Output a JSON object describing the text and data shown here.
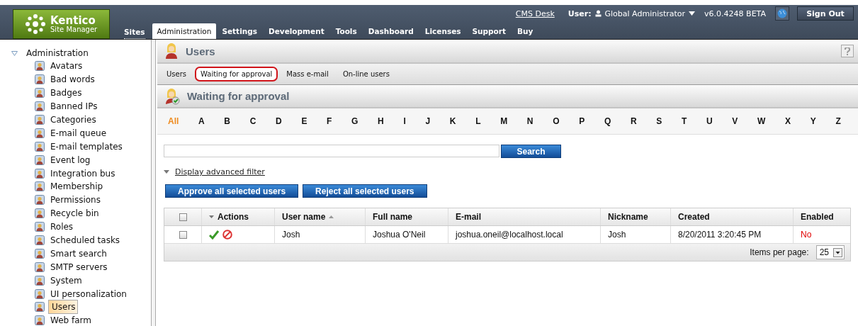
{
  "header": {
    "logo_title": "Kentico",
    "logo_subtitle": "Site Manager",
    "cms_desk_link": "CMS Desk",
    "user_label": "User:",
    "user_name": "Global Administrator",
    "version": "v6.0.4248 BETA",
    "sign_out": "Sign Out"
  },
  "sites_link": "Sites",
  "main_tabs": [
    {
      "label": "Administration",
      "selected": true
    },
    {
      "label": "Settings",
      "selected": false
    },
    {
      "label": "Development",
      "selected": false
    },
    {
      "label": "Tools",
      "selected": false
    },
    {
      "label": "Dashboard",
      "selected": false
    },
    {
      "label": "Licenses",
      "selected": false
    },
    {
      "label": "Support",
      "selected": false
    },
    {
      "label": "Buy",
      "selected": false
    }
  ],
  "sidebar": {
    "label": "Administration",
    "expanded": true,
    "children": [
      {
        "label": "Avatars",
        "selected": false
      },
      {
        "label": "Bad words",
        "selected": false
      },
      {
        "label": "Badges",
        "selected": false
      },
      {
        "label": "Banned IPs",
        "selected": false
      },
      {
        "label": "Categories",
        "selected": false
      },
      {
        "label": "E-mail queue",
        "selected": false
      },
      {
        "label": "E-mail templates",
        "selected": false
      },
      {
        "label": "Event log",
        "selected": false
      },
      {
        "label": "Integration bus",
        "selected": false
      },
      {
        "label": "Membership",
        "selected": false
      },
      {
        "label": "Permissions",
        "selected": false
      },
      {
        "label": "Recycle bin",
        "selected": false
      },
      {
        "label": "Roles",
        "selected": false
      },
      {
        "label": "Scheduled tasks",
        "selected": false
      },
      {
        "label": "Smart search",
        "selected": false
      },
      {
        "label": "SMTP servers",
        "selected": false
      },
      {
        "label": "System",
        "selected": false
      },
      {
        "label": "UI personalization",
        "selected": false
      },
      {
        "label": "Users",
        "selected": true
      },
      {
        "label": "Web farm",
        "selected": false
      }
    ]
  },
  "page_title": "Users",
  "sub_tabs": [
    {
      "label": "Users",
      "selected": false
    },
    {
      "label": "Waiting for approval",
      "selected": true
    },
    {
      "label": "Mass e-mail",
      "selected": false
    },
    {
      "label": "On-line users",
      "selected": false
    }
  ],
  "section_title": "Waiting for approval",
  "letters": [
    {
      "label": "All",
      "selected": true
    },
    {
      "label": "A",
      "selected": false
    },
    {
      "label": "B",
      "selected": false
    },
    {
      "label": "C",
      "selected": false
    },
    {
      "label": "D",
      "selected": false
    },
    {
      "label": "E",
      "selected": false
    },
    {
      "label": "F",
      "selected": false
    },
    {
      "label": "G",
      "selected": false
    },
    {
      "label": "H",
      "selected": false
    },
    {
      "label": "I",
      "selected": false
    },
    {
      "label": "J",
      "selected": false
    },
    {
      "label": "K",
      "selected": false
    },
    {
      "label": "L",
      "selected": false
    },
    {
      "label": "M",
      "selected": false
    },
    {
      "label": "N",
      "selected": false
    },
    {
      "label": "O",
      "selected": false
    },
    {
      "label": "P",
      "selected": false
    },
    {
      "label": "Q",
      "selected": false
    },
    {
      "label": "R",
      "selected": false
    },
    {
      "label": "S",
      "selected": false
    },
    {
      "label": "T",
      "selected": false
    },
    {
      "label": "U",
      "selected": false
    },
    {
      "label": "V",
      "selected": false
    },
    {
      "label": "W",
      "selected": false
    },
    {
      "label": "X",
      "selected": false
    },
    {
      "label": "Y",
      "selected": false
    },
    {
      "label": "Z",
      "selected": false
    }
  ],
  "search": {
    "button": "Search"
  },
  "advanced_filter_link": "Display advanced filter",
  "action_buttons": [
    "Approve all selected users",
    "Reject all selected users"
  ],
  "table": {
    "columns": [
      {
        "kind": "checkbox",
        "checked": false
      },
      {
        "kind": "menu",
        "label": "Actions"
      },
      {
        "kind": "sorted",
        "label": "User name"
      },
      {
        "kind": "plain",
        "label": "Full name"
      },
      {
        "kind": "plain",
        "label": "E-mail"
      },
      {
        "kind": "plain",
        "label": "Nickname"
      },
      {
        "kind": "plain",
        "label": "Created"
      },
      {
        "kind": "plain",
        "label": "Enabled"
      }
    ],
    "rows": [
      {
        "cells": [
          {
            "kind": "checkbox",
            "checked": false
          },
          {
            "kind": "actions"
          },
          {
            "kind": "text",
            "text": "Josh"
          },
          {
            "kind": "text",
            "text": "Joshua O'Neil"
          },
          {
            "kind": "text",
            "text": "joshua.oneil@localhost.local"
          },
          {
            "kind": "text",
            "text": "Josh"
          },
          {
            "kind": "text",
            "text": "8/20/2011 3:20:45 PM"
          },
          {
            "kind": "flag",
            "text": "No",
            "enabled": false
          }
        ]
      }
    ],
    "items_per_page_label": "Items per page:",
    "items_per_page": "25"
  }
}
